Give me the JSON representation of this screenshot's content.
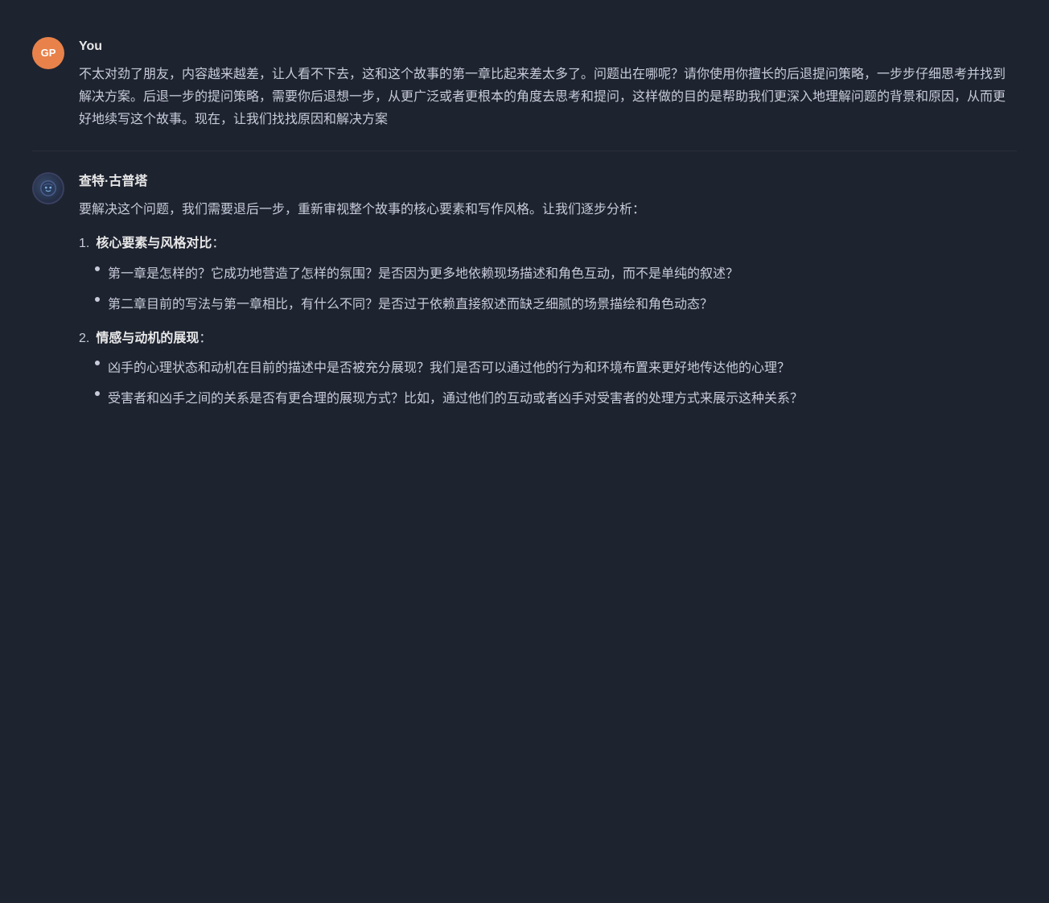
{
  "user": {
    "name": "You",
    "avatar_initials": "GP",
    "message": "不太对劲了朋友，内容越来越差，让人看不下去，这和这个故事的第一章比起来差太多了。问题出在哪呢？请你使用你擅长的后退提问策略，一步步仔细思考并找到解决方案。后退一步的提问策略，需要你后退想一步，从更广泛或者更根本的角度去思考和提问，这样做的目的是帮助我们更深入地理解问题的背景和原因，从而更好地续写这个故事。现在，让我们找找原因和解决方案"
  },
  "bot": {
    "name": "查特·古普塔",
    "intro": "要解决这个问题，我们需要退后一步，重新审视整个故事的核心要素和写作风格。让我们逐步分析：",
    "sections": [
      {
        "number": "1.",
        "label": "核心要素与风格对比",
        "colon": "：",
        "bullets": [
          "第一章是怎样的？它成功地营造了怎样的氛围？是否因为更多地依赖现场描述和角色互动，而不是单纯的叙述？",
          "第二章目前的写法与第一章相比，有什么不同？是否过于依赖直接叙述而缺乏细腻的场景描绘和角色动态？"
        ]
      },
      {
        "number": "2.",
        "label": "情感与动机的展现",
        "colon": "：",
        "bullets": [
          "凶手的心理状态和动机在目前的描述中是否被充分展现？我们是否可以通过他的行为和环境布置来更好地传达他的心理？",
          "受害者和凶手之间的关系是否有更合理的展现方式？比如，通过他们的互动或者凶手对受害者的处理方式来展示这种关系？"
        ]
      }
    ]
  }
}
